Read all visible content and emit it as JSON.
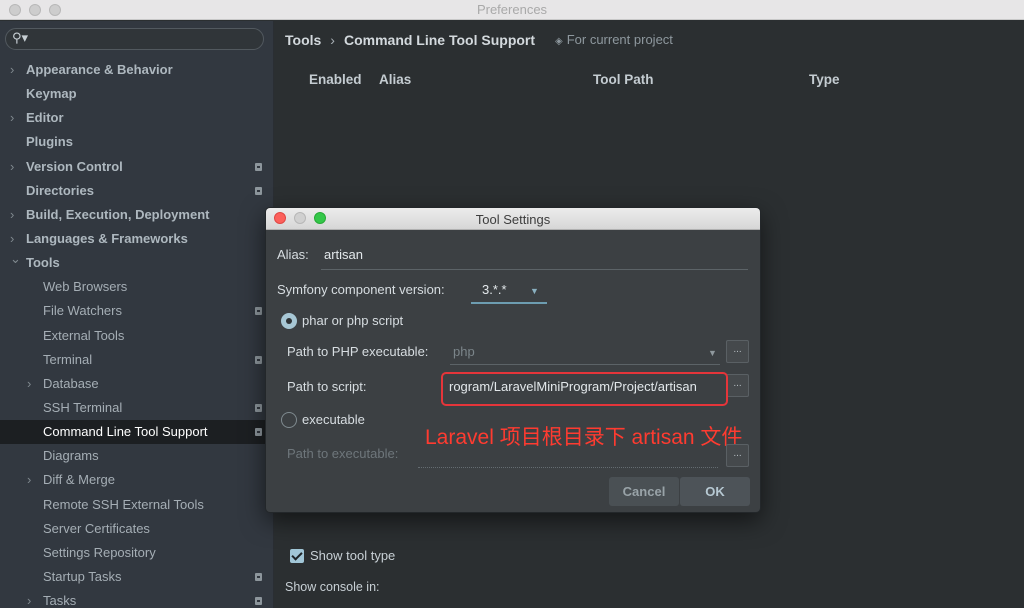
{
  "window": {
    "title": "Preferences"
  },
  "search": {
    "icon": "search-icon"
  },
  "sidebar": {
    "items": [
      {
        "label": "Appearance & Behavior",
        "level": 0,
        "expander": "collapsed",
        "badge": false
      },
      {
        "label": "Keymap",
        "level": 0,
        "expander": "none",
        "badge": false
      },
      {
        "label": "Editor",
        "level": 0,
        "expander": "collapsed",
        "badge": false
      },
      {
        "label": "Plugins",
        "level": 0,
        "expander": "none",
        "badge": false
      },
      {
        "label": "Version Control",
        "level": 0,
        "expander": "collapsed",
        "badge": true
      },
      {
        "label": "Directories",
        "level": 0,
        "expander": "none",
        "badge": true
      },
      {
        "label": "Build, Execution, Deployment",
        "level": 0,
        "expander": "collapsed",
        "badge": false
      },
      {
        "label": "Languages & Frameworks",
        "level": 0,
        "expander": "collapsed",
        "badge": false
      },
      {
        "label": "Tools",
        "level": 0,
        "expander": "expanded",
        "badge": false
      },
      {
        "label": "Web Browsers",
        "level": 1,
        "expander": "none",
        "badge": false
      },
      {
        "label": "File Watchers",
        "level": 1,
        "expander": "none",
        "badge": true
      },
      {
        "label": "External Tools",
        "level": 1,
        "expander": "none",
        "badge": false
      },
      {
        "label": "Terminal",
        "level": 1,
        "expander": "none",
        "badge": true
      },
      {
        "label": "Database",
        "level": 1,
        "expander": "collapsed",
        "badge": false
      },
      {
        "label": "SSH Terminal",
        "level": 1,
        "expander": "none",
        "badge": true
      },
      {
        "label": "Command Line Tool Support",
        "level": 1,
        "expander": "none",
        "badge": true,
        "selected": true
      },
      {
        "label": "Diagrams",
        "level": 1,
        "expander": "none",
        "badge": false
      },
      {
        "label": "Diff & Merge",
        "level": 1,
        "expander": "collapsed",
        "badge": false
      },
      {
        "label": "Remote SSH External Tools",
        "level": 1,
        "expander": "none",
        "badge": false
      },
      {
        "label": "Server Certificates",
        "level": 1,
        "expander": "none",
        "badge": false
      },
      {
        "label": "Settings Repository",
        "level": 1,
        "expander": "none",
        "badge": false
      },
      {
        "label": "Startup Tasks",
        "level": 1,
        "expander": "none",
        "badge": true
      },
      {
        "label": "Tasks",
        "level": 1,
        "expander": "collapsed",
        "badge": true
      }
    ]
  },
  "breadcrumb": {
    "parent": "Tools",
    "separator": "›",
    "current": "Command Line Tool Support",
    "scope": "For current project",
    "scope_icon": "project-scope-icon"
  },
  "table": {
    "columns": [
      "Enabled",
      "Alias",
      "Tool Path",
      "Type"
    ]
  },
  "main_footer": {
    "show_tool_type": "Show tool type",
    "show_tool_type_checked": true,
    "show_console_in": "Show console in:"
  },
  "dialog": {
    "title": "Tool Settings",
    "alias_label": "Alias:",
    "alias_value": "artisan",
    "symfony_label": "Symfony component version:",
    "symfony_value": "3.*.*",
    "phar_label": "phar or php script",
    "phar_selected": true,
    "php_exec_label": "Path to PHP executable:",
    "php_exec_value": "php",
    "script_label": "Path to script:",
    "script_value": "rogram/LaravelMiniProgram/Project/artisan",
    "executable_label": "executable",
    "executable_selected": false,
    "exec_path_label": "Path to executable:",
    "browse_label": "...",
    "annotation": "Laravel 项目根目录下 artisan 文件",
    "cancel_label": "Cancel",
    "ok_label": "OK"
  },
  "colors": {
    "annotation": "#ff3b30",
    "highlight_border": "#e5353a",
    "selection": "#1c1f22"
  }
}
